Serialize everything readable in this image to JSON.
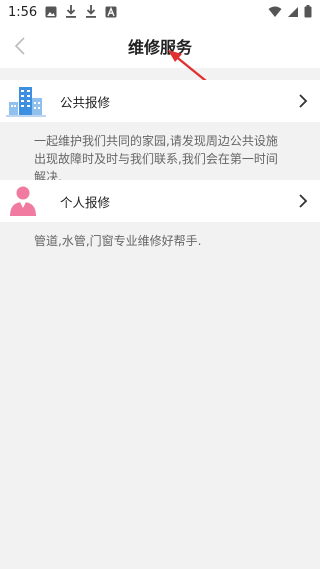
{
  "status_bar": {
    "time": "1:56"
  },
  "header": {
    "title": "维修服务"
  },
  "items": [
    {
      "label": "公共报修",
      "description": "一起维护我们共同的家园,请发现周边公共设施出现故障时及时与我们联系,我们会在第一时间解决."
    },
    {
      "label": "个人报修",
      "description": "管道,水管,门窗专业维修好帮手."
    }
  ],
  "colors": {
    "building_icon": "#3d8fe0",
    "person_icon": "#f07aa0",
    "annotation_arrow": "#e03030"
  }
}
